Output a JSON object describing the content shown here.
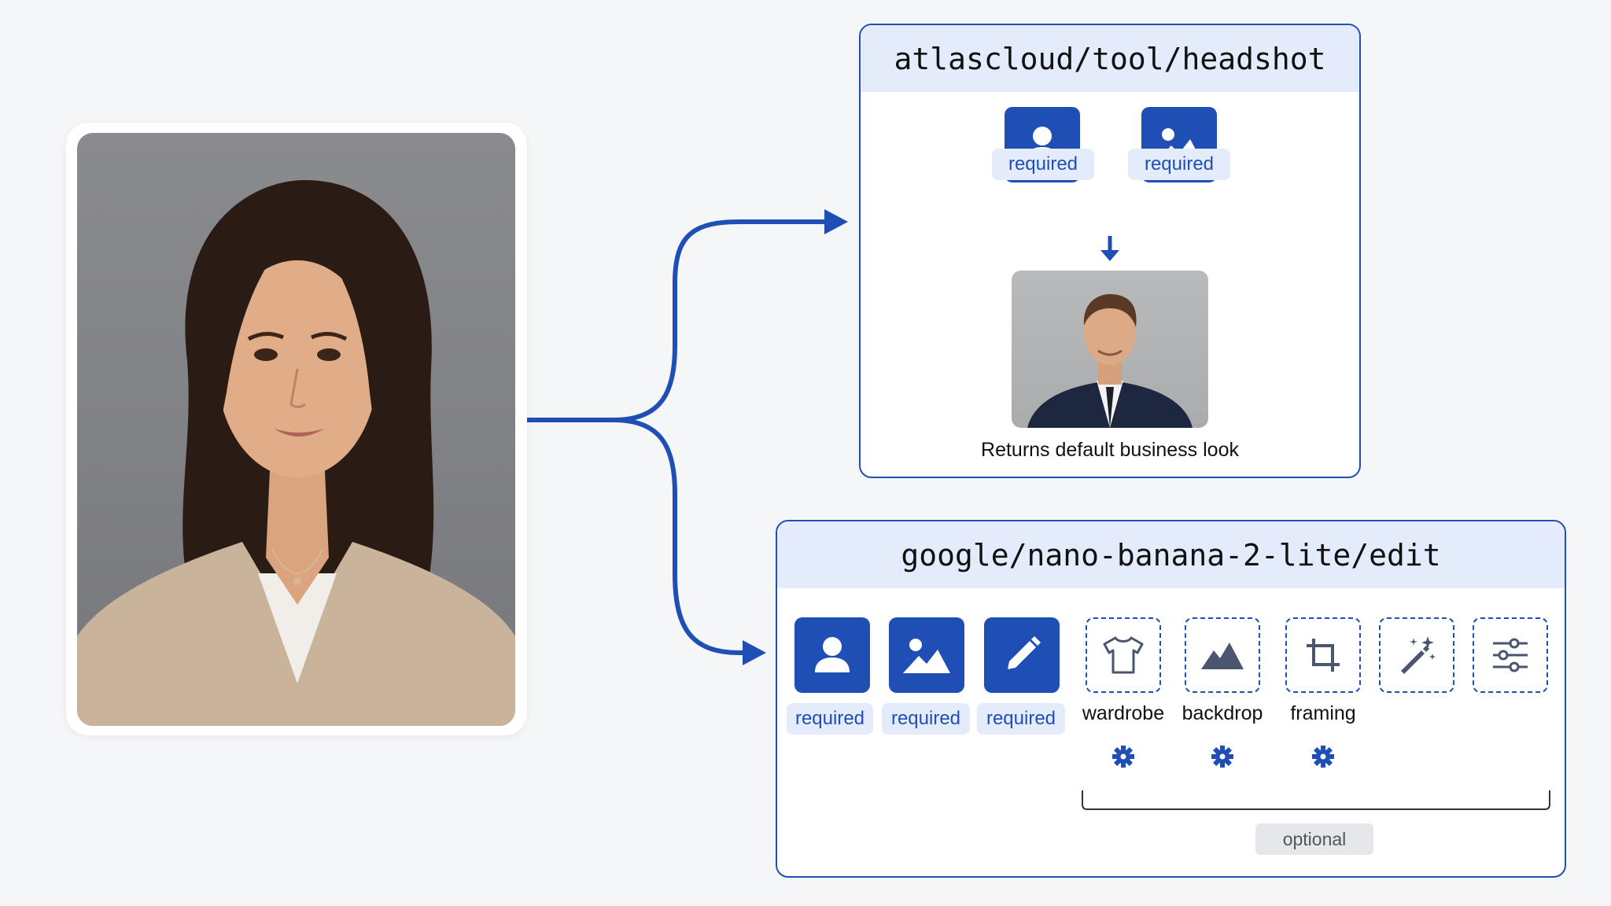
{
  "colors": {
    "accent": "#1f4fb5",
    "accent_light": "#e4ecfb",
    "background": "#f5f6f8"
  },
  "source": {
    "subject": "woman-portrait"
  },
  "tool_headshot": {
    "title": "atlascloud/tool/headshot",
    "inputs": [
      {
        "icon": "person-icon",
        "badge": "required"
      },
      {
        "icon": "image-icon",
        "badge": "required"
      }
    ],
    "output_caption": "Returns default business look"
  },
  "nano_banana": {
    "title": "google/nano-banana-2-lite/edit",
    "required_inputs": [
      {
        "icon": "person-icon",
        "badge": "required"
      },
      {
        "icon": "image-icon",
        "badge": "required"
      },
      {
        "icon": "pencil-icon",
        "badge": "required"
      }
    ],
    "optional_inputs": [
      {
        "icon": "shirt-icon",
        "label": "wardrobe"
      },
      {
        "icon": "mountain-icon",
        "label": "backdrop"
      },
      {
        "icon": "crop-icon",
        "label": "framing"
      },
      {
        "icon": "magic-wand-icon",
        "label": ""
      },
      {
        "icon": "sliders-icon",
        "label": ""
      }
    ],
    "optional_badge": "optional"
  }
}
